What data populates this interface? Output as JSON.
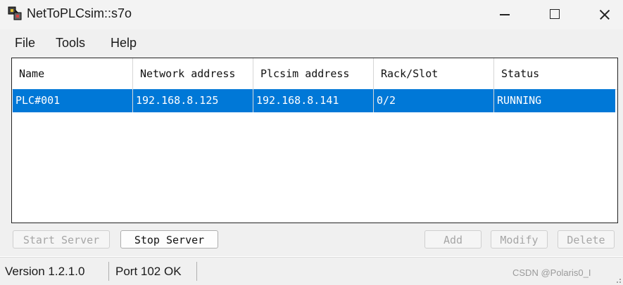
{
  "window": {
    "title": "NetToPLCsim::s7o"
  },
  "menu": {
    "items": [
      "File",
      "Tools",
      "Help"
    ]
  },
  "list": {
    "columns": [
      "Name",
      "Network address",
      "Plcsim address",
      "Rack/Slot",
      "Status"
    ],
    "rows": [
      {
        "name": "PLC#001",
        "network_address": "192.168.8.125",
        "plcsim_address": "192.168.8.141",
        "rack_slot": "0/2",
        "status": "RUNNING",
        "selected": true
      }
    ]
  },
  "buttons": {
    "start_server": "Start Server",
    "stop_server": "Stop Server",
    "add": "Add",
    "modify": "Modify",
    "delete": "Delete"
  },
  "status": {
    "version": "Version 1.2.1.0",
    "port": "Port 102 OK",
    "watermark": "CSDN @Polaris0_I"
  },
  "colors": {
    "selection": "#0078d7"
  }
}
